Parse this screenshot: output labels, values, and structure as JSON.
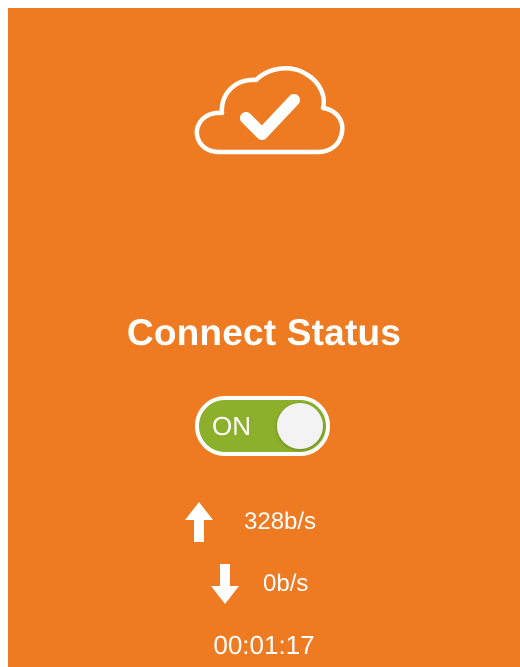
{
  "status": {
    "title": "Connect Status",
    "toggle_label": "ON",
    "toggle_state": "on",
    "upload_speed": "328b/s",
    "download_speed": "0b/s",
    "elapsed_time": "00:01:17"
  },
  "icons": {
    "cloud": "cloud-check-icon",
    "upload": "arrow-up-icon",
    "download": "arrow-down-icon"
  },
  "colors": {
    "background": "#ee7b22",
    "toggle_on": "#8cb02c",
    "text": "#ffffff"
  }
}
